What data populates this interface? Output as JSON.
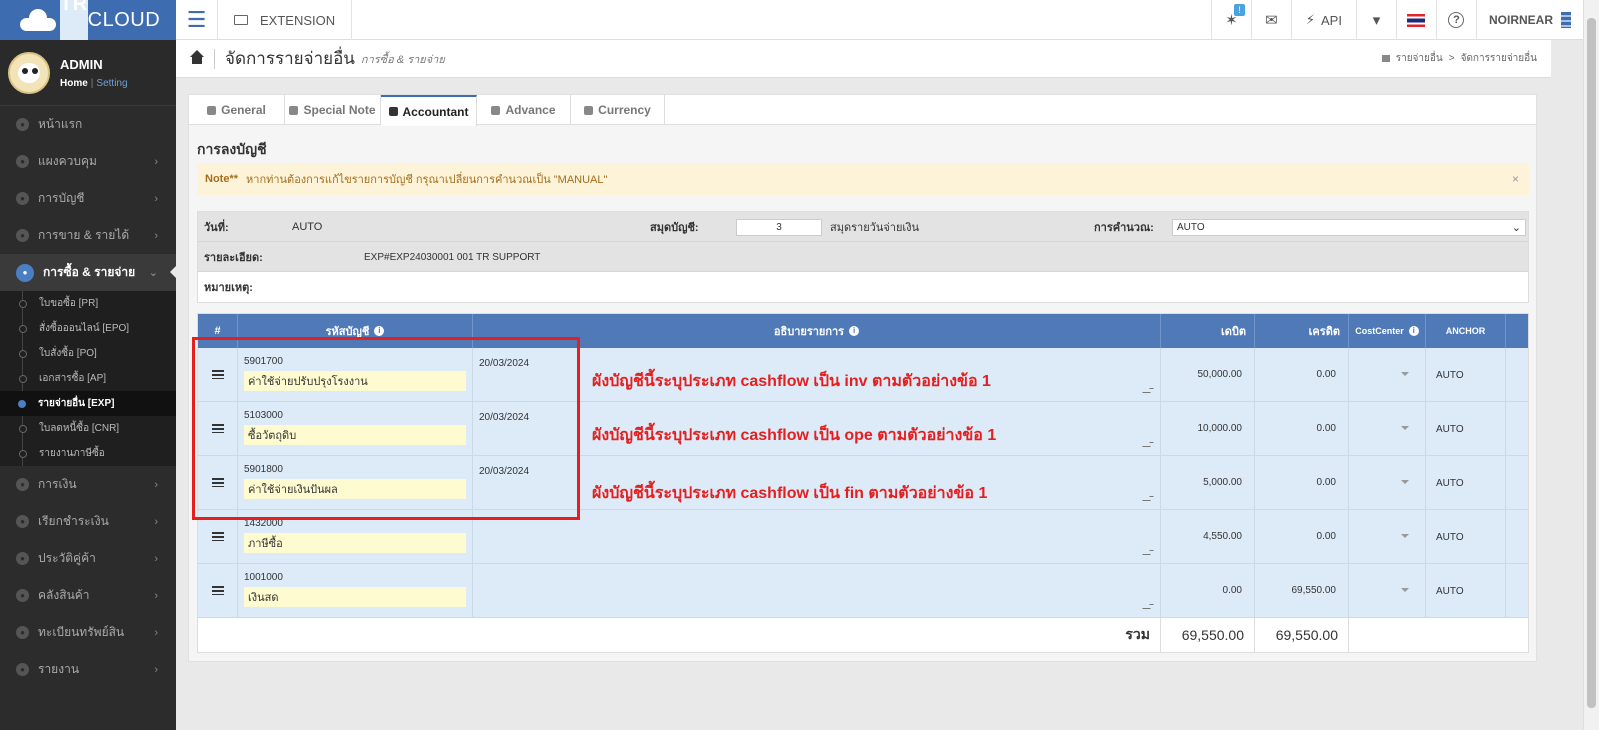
{
  "brand": {
    "part1": "TR",
    "part2": "CLOUD"
  },
  "topbar": {
    "extension_label": "EXTENSION",
    "notif_badge": "!",
    "api_label": "API",
    "help_label": "?",
    "user_label": "NOIRNEAR"
  },
  "profile": {
    "name": "ADMIN",
    "home_link": "Home",
    "setting_link": "Setting",
    "separator": "|"
  },
  "sidebar": {
    "items_top": [
      {
        "label": "หน้าแรก",
        "icon": "cloud-icon",
        "chevron": ""
      },
      {
        "label": "แผงควบคุม",
        "icon": "monitor-icon",
        "chevron": "›"
      },
      {
        "label": "การบัญชี",
        "icon": "book-icon",
        "chevron": "›"
      },
      {
        "label": "การขาย & รายได้",
        "icon": "dollar-icon",
        "chevron": "›"
      }
    ],
    "active_item": {
      "label": "การซื้อ & รายจ่าย",
      "icon": "cart-icon",
      "chevron": "⌄"
    },
    "sub_items": [
      {
        "label": "ใบขอซื้อ [PR]"
      },
      {
        "label": "สั่งซื้อออนไลน์ [EPO]"
      },
      {
        "label": "ใบสั่งซื้อ [PO]"
      },
      {
        "label": "เอกสารซื้อ [AP]"
      },
      {
        "label": "รายจ่ายอื่น [EXP]",
        "active": true
      },
      {
        "label": "ใบลดหนี้ซื้อ [CNR]"
      },
      {
        "label": "รายงานภาษีซื้อ"
      }
    ],
    "items_bottom": [
      {
        "label": "การเงิน",
        "icon": "coins-icon",
        "chevron": "›"
      },
      {
        "label": "เรียกชำระเงิน",
        "icon": "card-icon",
        "chevron": "›"
      },
      {
        "label": "ประวัติคู่ค้า",
        "icon": "contact-icon",
        "chevron": "›"
      },
      {
        "label": "คลังสินค้า",
        "icon": "cubes-icon",
        "chevron": "›"
      },
      {
        "label": "ทะเบียนทรัพย์สิน",
        "icon": "diamond-icon",
        "chevron": "›"
      },
      {
        "label": "รายงาน",
        "icon": "report-icon",
        "chevron": "›"
      }
    ]
  },
  "page": {
    "title": "จัดการรายจ่ายอื่น",
    "subtitle": "การซื้อ & รายจ่าย",
    "breadcrumb": [
      "รายจ่ายอื่น",
      "จัดการรายจ่ายอื่น"
    ],
    "breadcrumb_sep": ">"
  },
  "tabs": [
    {
      "label": "General",
      "active": false
    },
    {
      "label": "Special Note",
      "active": false
    },
    {
      "label": "Accountant",
      "active": true
    },
    {
      "label": "Advance",
      "active": false
    },
    {
      "label": "Currency",
      "active": false
    }
  ],
  "section_title": "การลงบัญชี",
  "note": {
    "label": "Note**",
    "text": "หากท่านต้องการแก้ไขรายการบัญชี กรุณาเปลี่ยนการคำนวณเป็น \"MANUAL\"",
    "close": "×"
  },
  "info": {
    "date_label": "วันที่:",
    "date_value": "AUTO",
    "journal_label": "สมุดบัญชี:",
    "journal_no": "3",
    "journal_name": "สมุดรายวันจ่ายเงิน",
    "calc_label": "การคำนวณ:",
    "calc_value": "AUTO",
    "detail_label": "รายละเอียด:",
    "detail_value": "EXP#EXP24030001 001 TR SUPPORT",
    "remark_label": "หมายเหตุ:"
  },
  "table": {
    "headers": {
      "num": "#",
      "code": "รหัสบัญชี",
      "desc": "อธิบายรายการ",
      "debit": "เดบิต",
      "credit": "เครดิต",
      "cost": "CostCenter",
      "anchor": "ANCHOR"
    },
    "rows": [
      {
        "code": "5901700",
        "name": "ค่าใช้จ่ายปรับปรุงโรงงาน",
        "date": "20/03/2024",
        "debit": "50,000.00",
        "credit": "0.00",
        "anchor": "AUTO",
        "annotation": "ผังบัญชีนี้ระบุประเภท cashflow เป็น inv ตามตัวอย่างข้อ 1"
      },
      {
        "code": "5103000",
        "name": "ซื้อวัตถุดิบ",
        "date": "20/03/2024",
        "debit": "10,000.00",
        "credit": "0.00",
        "anchor": "AUTO",
        "annotation": "ผังบัญชีนี้ระบุประเภท cashflow เป็น ope ตามตัวอย่างข้อ 1"
      },
      {
        "code": "5901800",
        "name": "ค่าใช้จ่ายเงินปันผล",
        "date": "20/03/2024",
        "debit": "5,000.00",
        "credit": "0.00",
        "anchor": "AUTO",
        "annotation": "ผังบัญชีนี้ระบุประเภท cashflow เป็น fin ตามตัวอย่างข้อ 1"
      },
      {
        "code": "1432000",
        "name": "ภาษีซื้อ",
        "date": "",
        "debit": "4,550.00",
        "credit": "0.00",
        "anchor": "AUTO",
        "annotation": ""
      },
      {
        "code": "1001000",
        "name": "เงินสด",
        "date": "",
        "debit": "0.00",
        "credit": "69,550.00",
        "anchor": "AUTO",
        "annotation": ""
      }
    ],
    "total_label": "รวม",
    "total_debit": "69,550.00",
    "total_credit": "69,550.00"
  },
  "colors": {
    "brand": "#3d6cb0",
    "table_header": "#5079b8",
    "row_bg": "#dcebf7",
    "annotation": "#e61e1e",
    "note_bg": "#fcf3d9"
  }
}
